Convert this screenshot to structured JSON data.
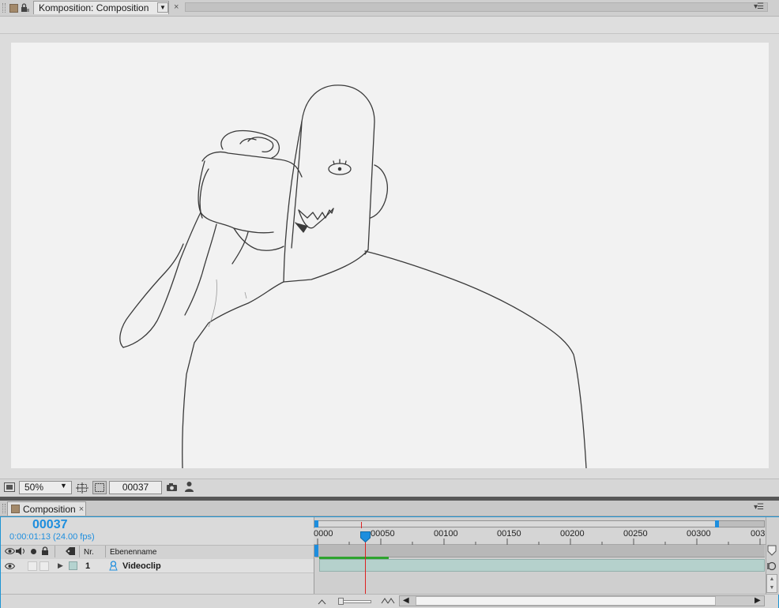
{
  "top_panel": {
    "tab_label": "Komposition: Composition",
    "menu_icon": "panel-menu-icon"
  },
  "viewer": {
    "canvas_content": "pencil sketch of a figure holding a mask",
    "zoom_value": "50%",
    "current_frame": "00037"
  },
  "timeline": {
    "tab_label": "Composition",
    "close_label": "×",
    "timecode": "00037",
    "timecode_detail": "0:00:01:13 (24.00 fps)",
    "columns": {
      "nr": "Nr.",
      "layer_name": "Ebenenname"
    },
    "layers": [
      {
        "number": "1",
        "name": "Videoclip"
      }
    ],
    "ruler_ticks": [
      "0000",
      "00050",
      "00100",
      "00150",
      "00200",
      "00250",
      "00300",
      "003"
    ],
    "playhead_frame": 37
  },
  "colors": {
    "accent": "#1d8ede",
    "playhead": "#dd2222",
    "layer_bar": "#b5d1cc",
    "cache": "#2ea32e",
    "label": "#b5d3d0",
    "comp_swatch": "#a3896a"
  }
}
